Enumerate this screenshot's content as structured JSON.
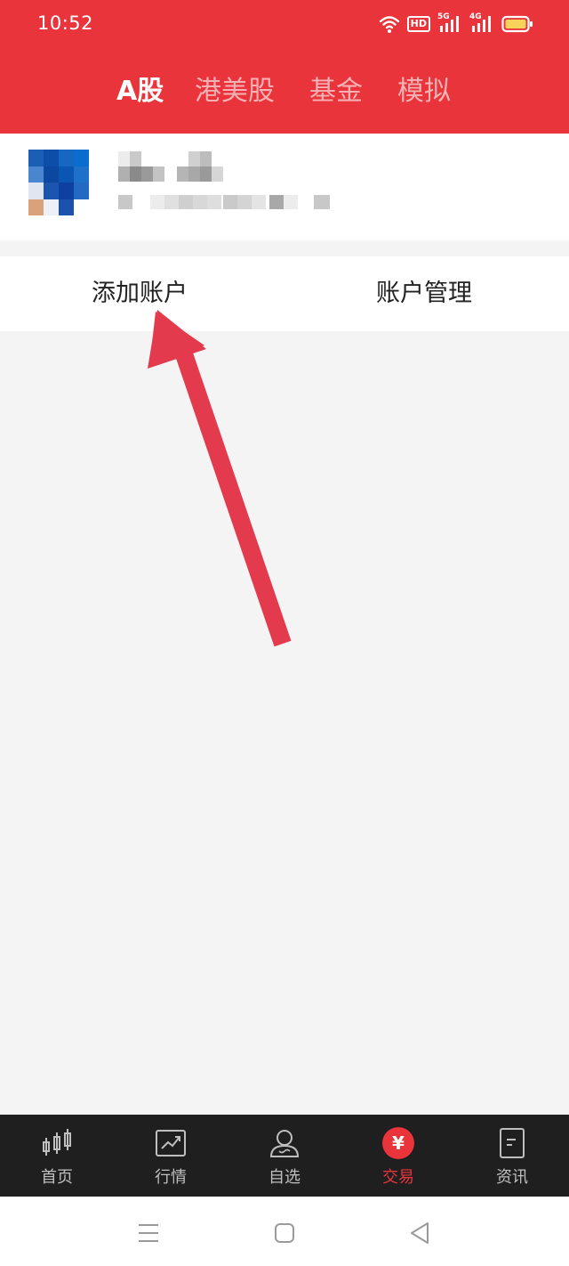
{
  "status_bar": {
    "time": "10:52",
    "icons": [
      "wifi-icon",
      "hd-icon",
      "signal-5g-icon",
      "signal-4g-icon",
      "battery-icon"
    ],
    "hd_label": "HD",
    "net1": "5G",
    "net2": "4G"
  },
  "top_tabs": [
    {
      "label": "A股",
      "active": true
    },
    {
      "label": "港美股",
      "active": false
    },
    {
      "label": "基金",
      "active": false
    },
    {
      "label": "模拟",
      "active": false
    }
  ],
  "account_actions": {
    "add_label": "添加账户",
    "manage_label": "账户管理"
  },
  "bottom_tabs": [
    {
      "label": "首页",
      "icon": "candlestick-icon",
      "active": false
    },
    {
      "label": "行情",
      "icon": "trend-chart-icon",
      "active": false
    },
    {
      "label": "自选",
      "icon": "user-icon",
      "active": false
    },
    {
      "label": "交易",
      "icon": "yuan-icon",
      "active": true
    },
    {
      "label": "资讯",
      "icon": "document-icon",
      "active": false
    }
  ],
  "trade_symbol": "¥",
  "colors": {
    "brand_red": "#e8343a",
    "tabbar_bg": "#1f1f1f",
    "page_bg": "#f4f4f4",
    "annotation_arrow": "#e33a4d"
  }
}
